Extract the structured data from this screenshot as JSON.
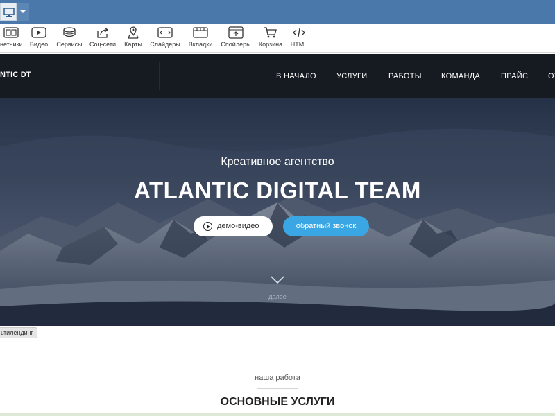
{
  "toolbar": {
    "items": [
      {
        "label": "нетчики",
        "icon": "counters-icon"
      },
      {
        "label": "Видео",
        "icon": "video-icon"
      },
      {
        "label": "Сервисы",
        "icon": "services-icon"
      },
      {
        "label": "Соц-сети",
        "icon": "share-icon"
      },
      {
        "label": "Карты",
        "icon": "map-pin-icon"
      },
      {
        "label": "Слайдеры",
        "icon": "slider-icon"
      },
      {
        "label": "Вкладки",
        "icon": "tabs-icon"
      },
      {
        "label": "Спойлеры",
        "icon": "spoiler-icon"
      },
      {
        "label": "Корзина",
        "icon": "cart-icon"
      },
      {
        "label": "HTML",
        "icon": "code-icon"
      }
    ]
  },
  "site": {
    "logo": "NTIC DT",
    "nav": [
      "В НАЧАЛО",
      "УСЛУГИ",
      "РАБОТЫ",
      "КОМАНДА",
      "ПРАЙС",
      "ОТ"
    ]
  },
  "hero": {
    "subtitle": "Креативное агентство",
    "title": "ATLANTIC DIGITAL TEAM",
    "btn_video": "демо-видео",
    "btn_callback": "обратный звонок",
    "scroll_label": "далее"
  },
  "block_label": "ьтилендинг",
  "section": {
    "kicker": "наша работа",
    "title": "ОСНОВНЫЕ УСЛУГИ"
  },
  "colors": {
    "topbar": "#4a78ab",
    "nav_bg": "#161b22",
    "accent": "#3aa7e4"
  }
}
